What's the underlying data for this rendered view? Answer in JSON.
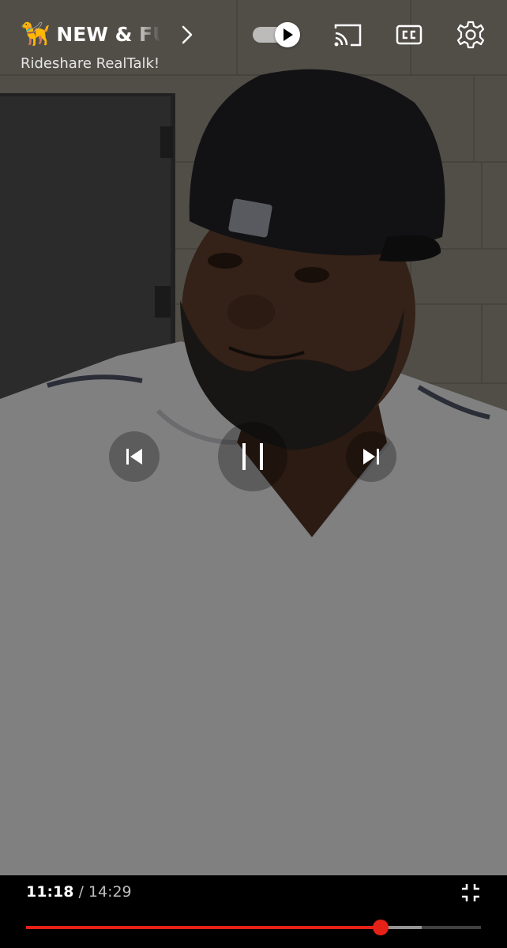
{
  "video": {
    "description_icon": "video-frame"
  },
  "header": {
    "channel_emoji": "🦮",
    "title": "NEW & FUNNY",
    "subtitle": "Rideshare RealTalk!"
  },
  "controls": {
    "autoplay_on": true,
    "icons": [
      "chevron-right-icon",
      "autoplay-toggle",
      "cast-icon",
      "closed-captions-icon",
      "settings-icon",
      "previous-icon",
      "pause-icon",
      "next-icon",
      "exit-fullscreen-icon"
    ]
  },
  "playback": {
    "current_time": "11:18",
    "separator": "/",
    "duration": "14:29",
    "played_fraction": 0.78,
    "buffered_fraction": 0.87
  },
  "colors": {
    "progress_played": "#e62117",
    "background": "#000000",
    "text": "#ffffff"
  }
}
